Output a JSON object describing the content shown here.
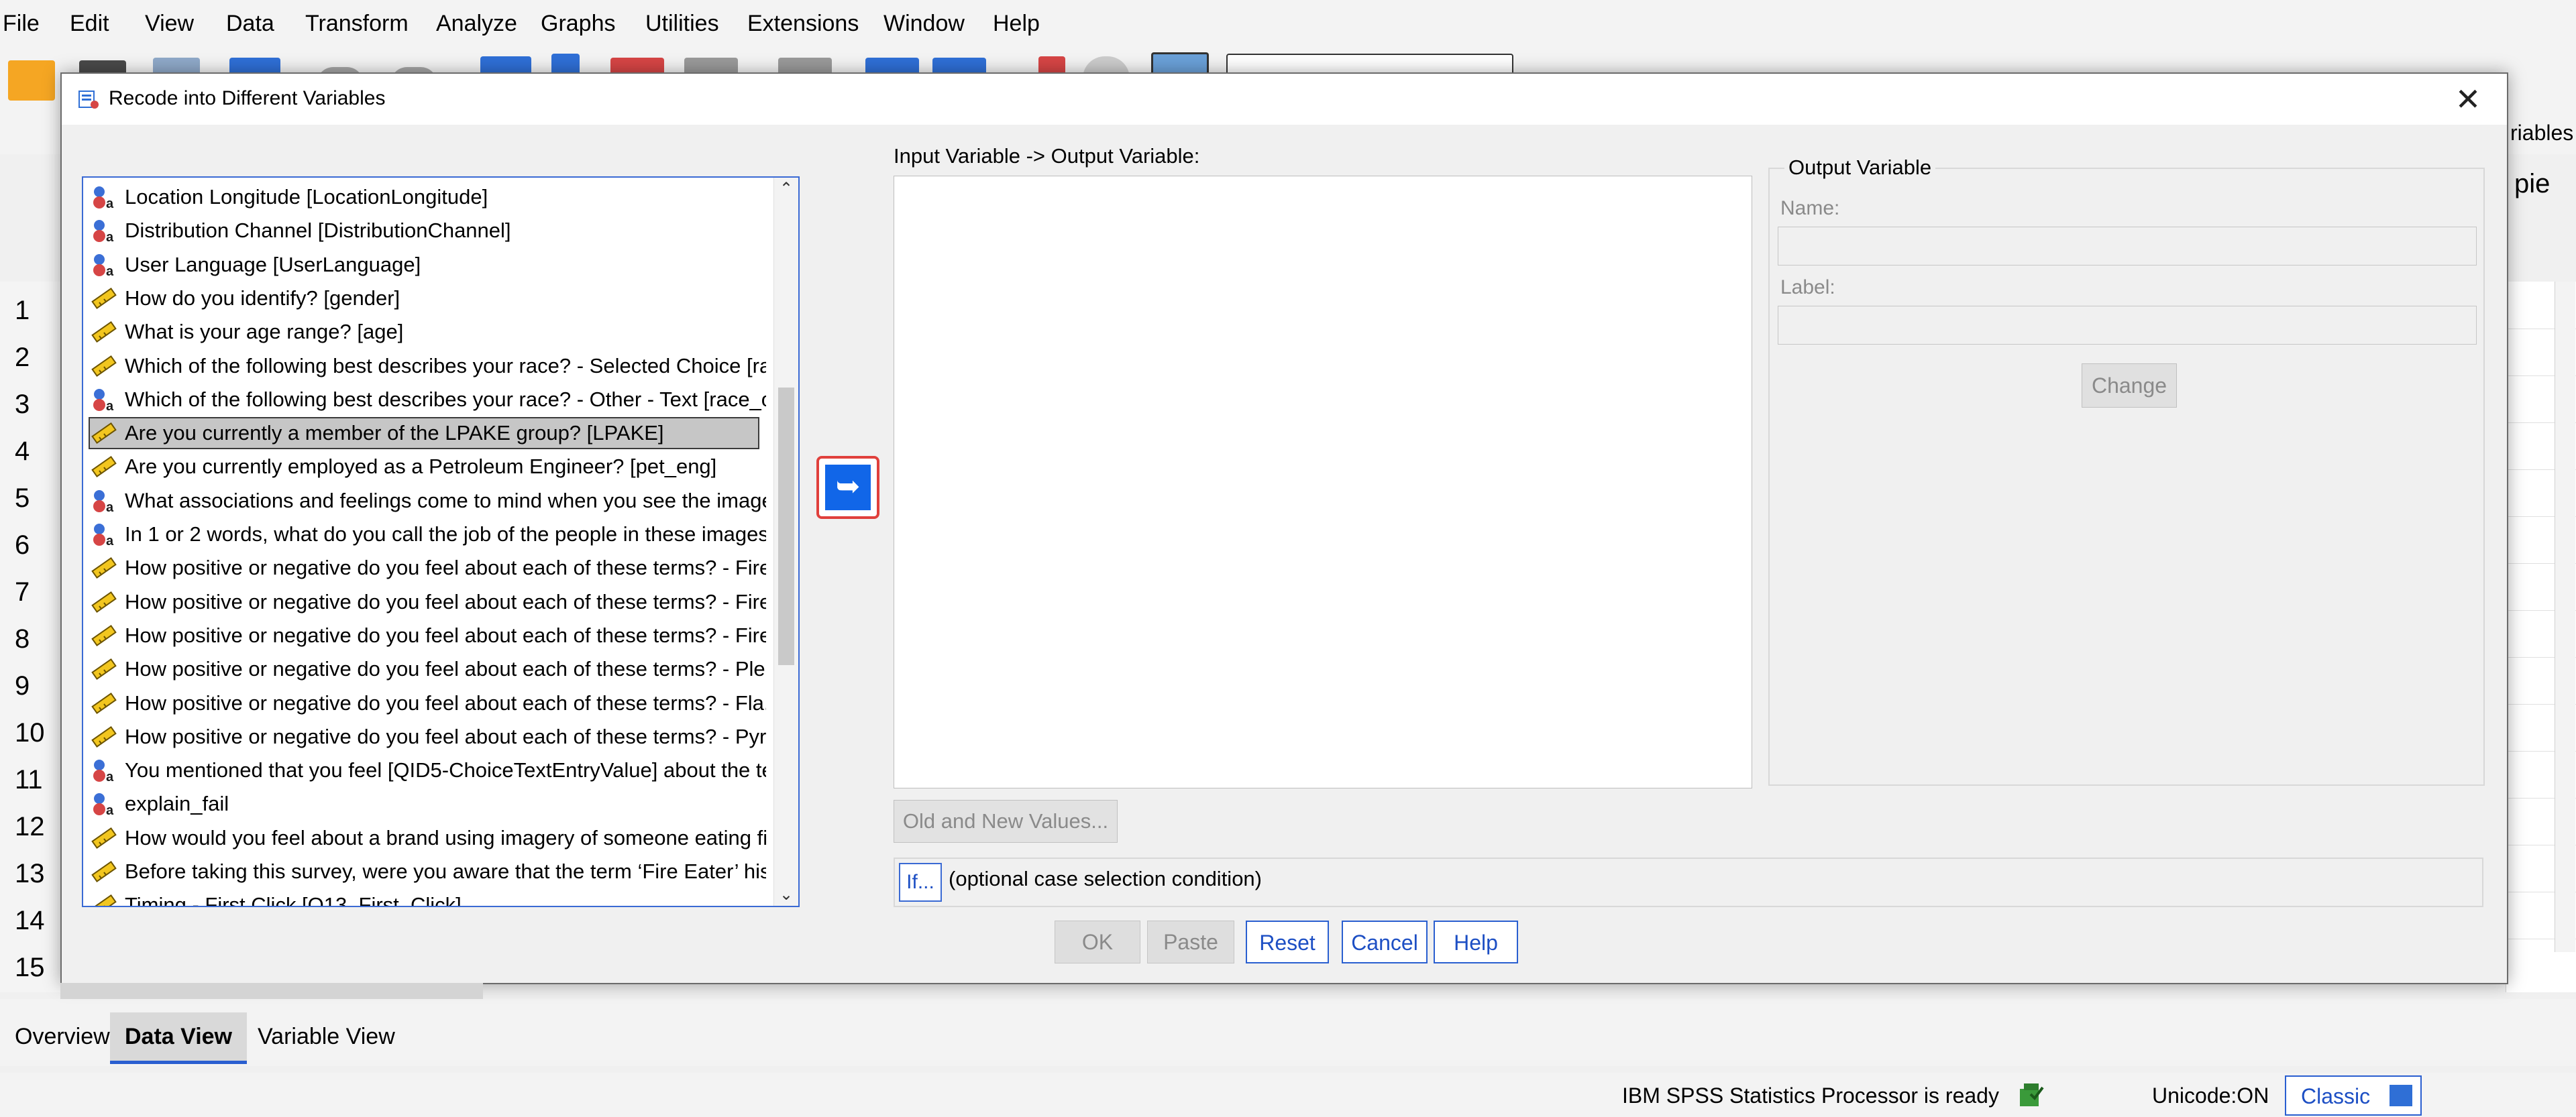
{
  "menubar": {
    "items": [
      "File",
      "Edit",
      "View",
      "Data",
      "Transform",
      "Analyze",
      "Graphs",
      "Utilities",
      "Extensions",
      "Window",
      "Help"
    ]
  },
  "background": {
    "row_numbers": [
      "1",
      "2",
      "3",
      "4",
      "5",
      "6",
      "7",
      "8",
      "9",
      "10",
      "11",
      "12",
      "13",
      "14",
      "15"
    ],
    "right_header_fragment": "riables",
    "right_header_fragment2": "pie"
  },
  "dialog": {
    "title": "Recode into Different Variables",
    "close_glyph": "✕",
    "variables": [
      {
        "label": "Location Longitude [LocationLongitude]",
        "type": "nominal"
      },
      {
        "label": "Distribution Channel [DistributionChannel]",
        "type": "nominal"
      },
      {
        "label": "User Language [UserLanguage]",
        "type": "nominal"
      },
      {
        "label": "How do you identify? [gender]",
        "type": "scale"
      },
      {
        "label": "What is your age range? [age]",
        "type": "scale"
      },
      {
        "label": "Which of the following best describes your race? - Selected Choice [ra",
        "type": "scale"
      },
      {
        "label": "Which of the following best describes your race? - Other - Text [race_o",
        "type": "nominal"
      },
      {
        "label": "Are you currently a member of the LPAKE group? [LPAKE]",
        "type": "scale",
        "selected": true
      },
      {
        "label": "Are you currently employed as a Petroleum Engineer? [pet_eng]",
        "type": "scale"
      },
      {
        "label": "What associations and feelings come to mind when you see the image",
        "type": "nominal"
      },
      {
        "label": "In 1 or 2 words, what do you call the job of the people in these images?",
        "type": "nominal"
      },
      {
        "label": "How positive or negative do you feel about each of these terms? - Fire",
        "type": "scale"
      },
      {
        "label": "How positive or negative do you feel about each of these terms? - Fire",
        "type": "scale"
      },
      {
        "label": "How positive or negative do you feel about each of these terms? - Fire",
        "type": "scale"
      },
      {
        "label": "How positive or negative do you feel about each of these terms? - Ple.",
        "type": "scale"
      },
      {
        "label": "How positive or negative do you feel about each of these terms? - Fla.",
        "type": "scale"
      },
      {
        "label": "How positive or negative do you feel about each of these terms? - Pyr.",
        "type": "scale"
      },
      {
        "label": "You mentioned that you feel [QID5-ChoiceTextEntryValue] about the te",
        "type": "nominal"
      },
      {
        "label": "explain_fail",
        "type": "nominal"
      },
      {
        "label": "How would you feel about a brand using imagery of someone eating fir",
        "type": "scale"
      },
      {
        "label": "Before taking this survey, were you aware that the term ‘Fire Eater’ his",
        "type": "scale"
      },
      {
        "label": "Timing - First Click [Q13_First_Click]",
        "type": "scale"
      }
    ],
    "move_button_glyph": "➥",
    "io_label": "Input Variable -> Output Variable:",
    "output_group": {
      "title": "Output Variable",
      "name_label": "Name:",
      "name_value": "",
      "label_label": "Label:",
      "label_value": "",
      "change_label": "Change"
    },
    "old_new_label": "Old and New Values...",
    "if_label": "If...",
    "if_text": "(optional case selection condition)",
    "buttons": {
      "ok": "OK",
      "paste": "Paste",
      "reset": "Reset",
      "cancel": "Cancel",
      "help": "Help"
    }
  },
  "view_tabs": [
    "Overview",
    "Data View",
    "Variable View"
  ],
  "active_view_tab": "Data View",
  "status": {
    "processor": "IBM SPSS Statistics Processor is ready",
    "unicode": "Unicode:ON",
    "mode": "Classic"
  },
  "colors": {
    "accent_blue": "#1166e8",
    "annotation_red": "#e53935",
    "selection_gray": "#c6c6c6"
  }
}
